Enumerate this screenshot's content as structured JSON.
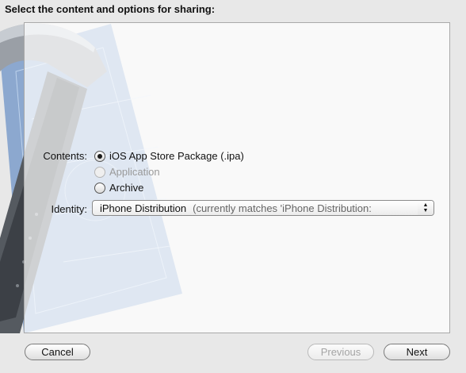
{
  "header": {
    "title": "Select the content and options for sharing:"
  },
  "form": {
    "contents_label": "Contents:",
    "contents_options": [
      {
        "label": "iOS App Store Package (.ipa)",
        "selected": true,
        "enabled": true
      },
      {
        "label": "Application",
        "selected": false,
        "enabled": false
      },
      {
        "label": "Archive",
        "selected": false,
        "enabled": true
      }
    ],
    "identity_label": "Identity:",
    "identity_popup": {
      "value": "iPhone Distribution",
      "detail": "(currently matches 'iPhone Distribution:"
    }
  },
  "buttons": {
    "cancel": "Cancel",
    "previous": "Previous",
    "next": "Next"
  }
}
